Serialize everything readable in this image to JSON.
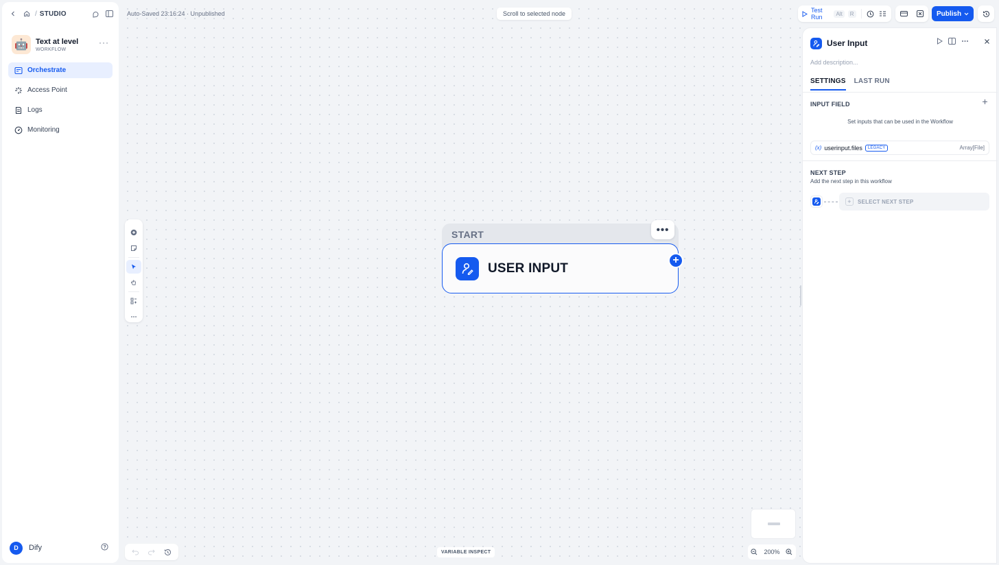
{
  "sidebar": {
    "breadcrumb": "STUDIO",
    "app": {
      "emoji": "🤖",
      "name": "Text at level",
      "type": "WORKFLOW"
    },
    "nav": [
      {
        "label": "Orchestrate",
        "icon": "orchestrate-icon",
        "active": true
      },
      {
        "label": "Access Point",
        "icon": "access-point-icon",
        "active": false
      },
      {
        "label": "Logs",
        "icon": "logs-icon",
        "active": false
      },
      {
        "label": "Monitoring",
        "icon": "monitoring-icon",
        "active": false
      }
    ],
    "user": {
      "initial": "D",
      "name": "Dify"
    }
  },
  "canvas": {
    "autosave": "Auto-Saved 23:16:24 · Unpublished",
    "scroll_button": "Scroll to selected node",
    "node": {
      "group_label": "START",
      "title": "USER INPUT"
    },
    "variable_inspect": "VARIABLE INSPECT",
    "zoom": "200%"
  },
  "header": {
    "test_run": "Test Run",
    "shortcut_key1": "Alt",
    "shortcut_key2": "R",
    "publish": "Publish"
  },
  "panel": {
    "title": "User Input",
    "description_placeholder": "Add description...",
    "tabs": [
      "SETTINGS",
      "LAST RUN"
    ],
    "input_field": {
      "title": "INPUT FIELD",
      "hint": "Set inputs that can be used in the Workflow",
      "variable": {
        "prefix": "(x)",
        "name": "userinput.files",
        "badge": "LEGACY",
        "type": "Array[File]"
      }
    },
    "next_step": {
      "title": "NEXT STEP",
      "subtitle": "Add the next step in this workflow",
      "select_label": "SELECT NEXT STEP"
    }
  },
  "colors": {
    "accent": "#155aef",
    "canvas_bg": "#f2f4f7"
  }
}
